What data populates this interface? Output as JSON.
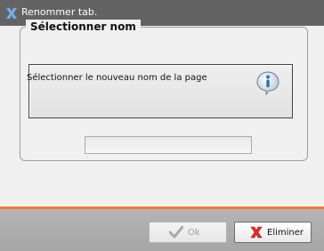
{
  "window": {
    "title": "Renommer tab."
  },
  "group": {
    "title": "Sélectionner nom"
  },
  "info": {
    "message": "Sélectionner le nouveau nom de la page",
    "icon": "info-icon"
  },
  "name_input": {
    "value": "",
    "placeholder": ""
  },
  "buttons": {
    "ok_label": "Ok",
    "ok_enabled": false,
    "delete_label": "Eliminer"
  },
  "colors": {
    "titlebar": "#636363",
    "accent": "#ef7a3b",
    "footer": "#acacac"
  }
}
